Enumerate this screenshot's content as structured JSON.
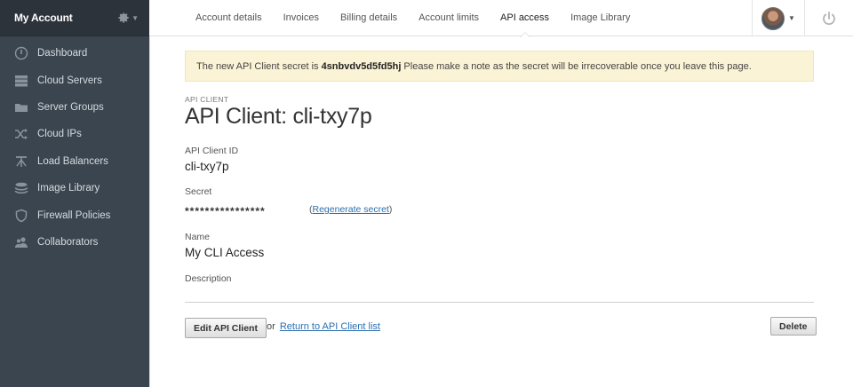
{
  "sidebar": {
    "title": "My Account",
    "items": [
      {
        "label": "Dashboard",
        "icon": "dashboard-icon"
      },
      {
        "label": "Cloud Servers",
        "icon": "servers-icon"
      },
      {
        "label": "Server Groups",
        "icon": "folder-icon"
      },
      {
        "label": "Cloud IPs",
        "icon": "shuffle-icon"
      },
      {
        "label": "Load Balancers",
        "icon": "load-balancer-icon"
      },
      {
        "label": "Image Library",
        "icon": "stack-icon"
      },
      {
        "label": "Firewall Policies",
        "icon": "shield-icon"
      },
      {
        "label": "Collaborators",
        "icon": "users-icon"
      }
    ]
  },
  "tabs": [
    "Account details",
    "Invoices",
    "Billing details",
    "Account limits",
    "API access",
    "Image Library"
  ],
  "active_tab": "API access",
  "alert": {
    "prefix": "The new API Client secret is",
    "secret": "4snbvdv5d5fd5hj",
    "suffix": "Please make a note as the secret will be irrecoverable once you leave this page."
  },
  "page": {
    "eyebrow": "API CLIENT",
    "title": "API Client: cli-txy7p"
  },
  "fields": {
    "client_id_label": "API Client ID",
    "client_id_value": "cli-txy7p",
    "secret_label": "Secret",
    "secret_mask": "****************",
    "regenerate_open": "(",
    "regenerate_link": "Regenerate secret",
    "regenerate_close": ")",
    "name_label": "Name",
    "name_value": "My CLI Access",
    "description_label": "Description"
  },
  "actions": {
    "edit_label": "Edit API Client",
    "or_text": "or",
    "return_link": "Return to API Client list",
    "delete_label": "Delete"
  },
  "colors": {
    "sidebar_bg": "#3b4550",
    "sidebar_header_bg": "#2c333b",
    "alert_bg": "#fbf3d5",
    "link": "#2a6fb0"
  }
}
